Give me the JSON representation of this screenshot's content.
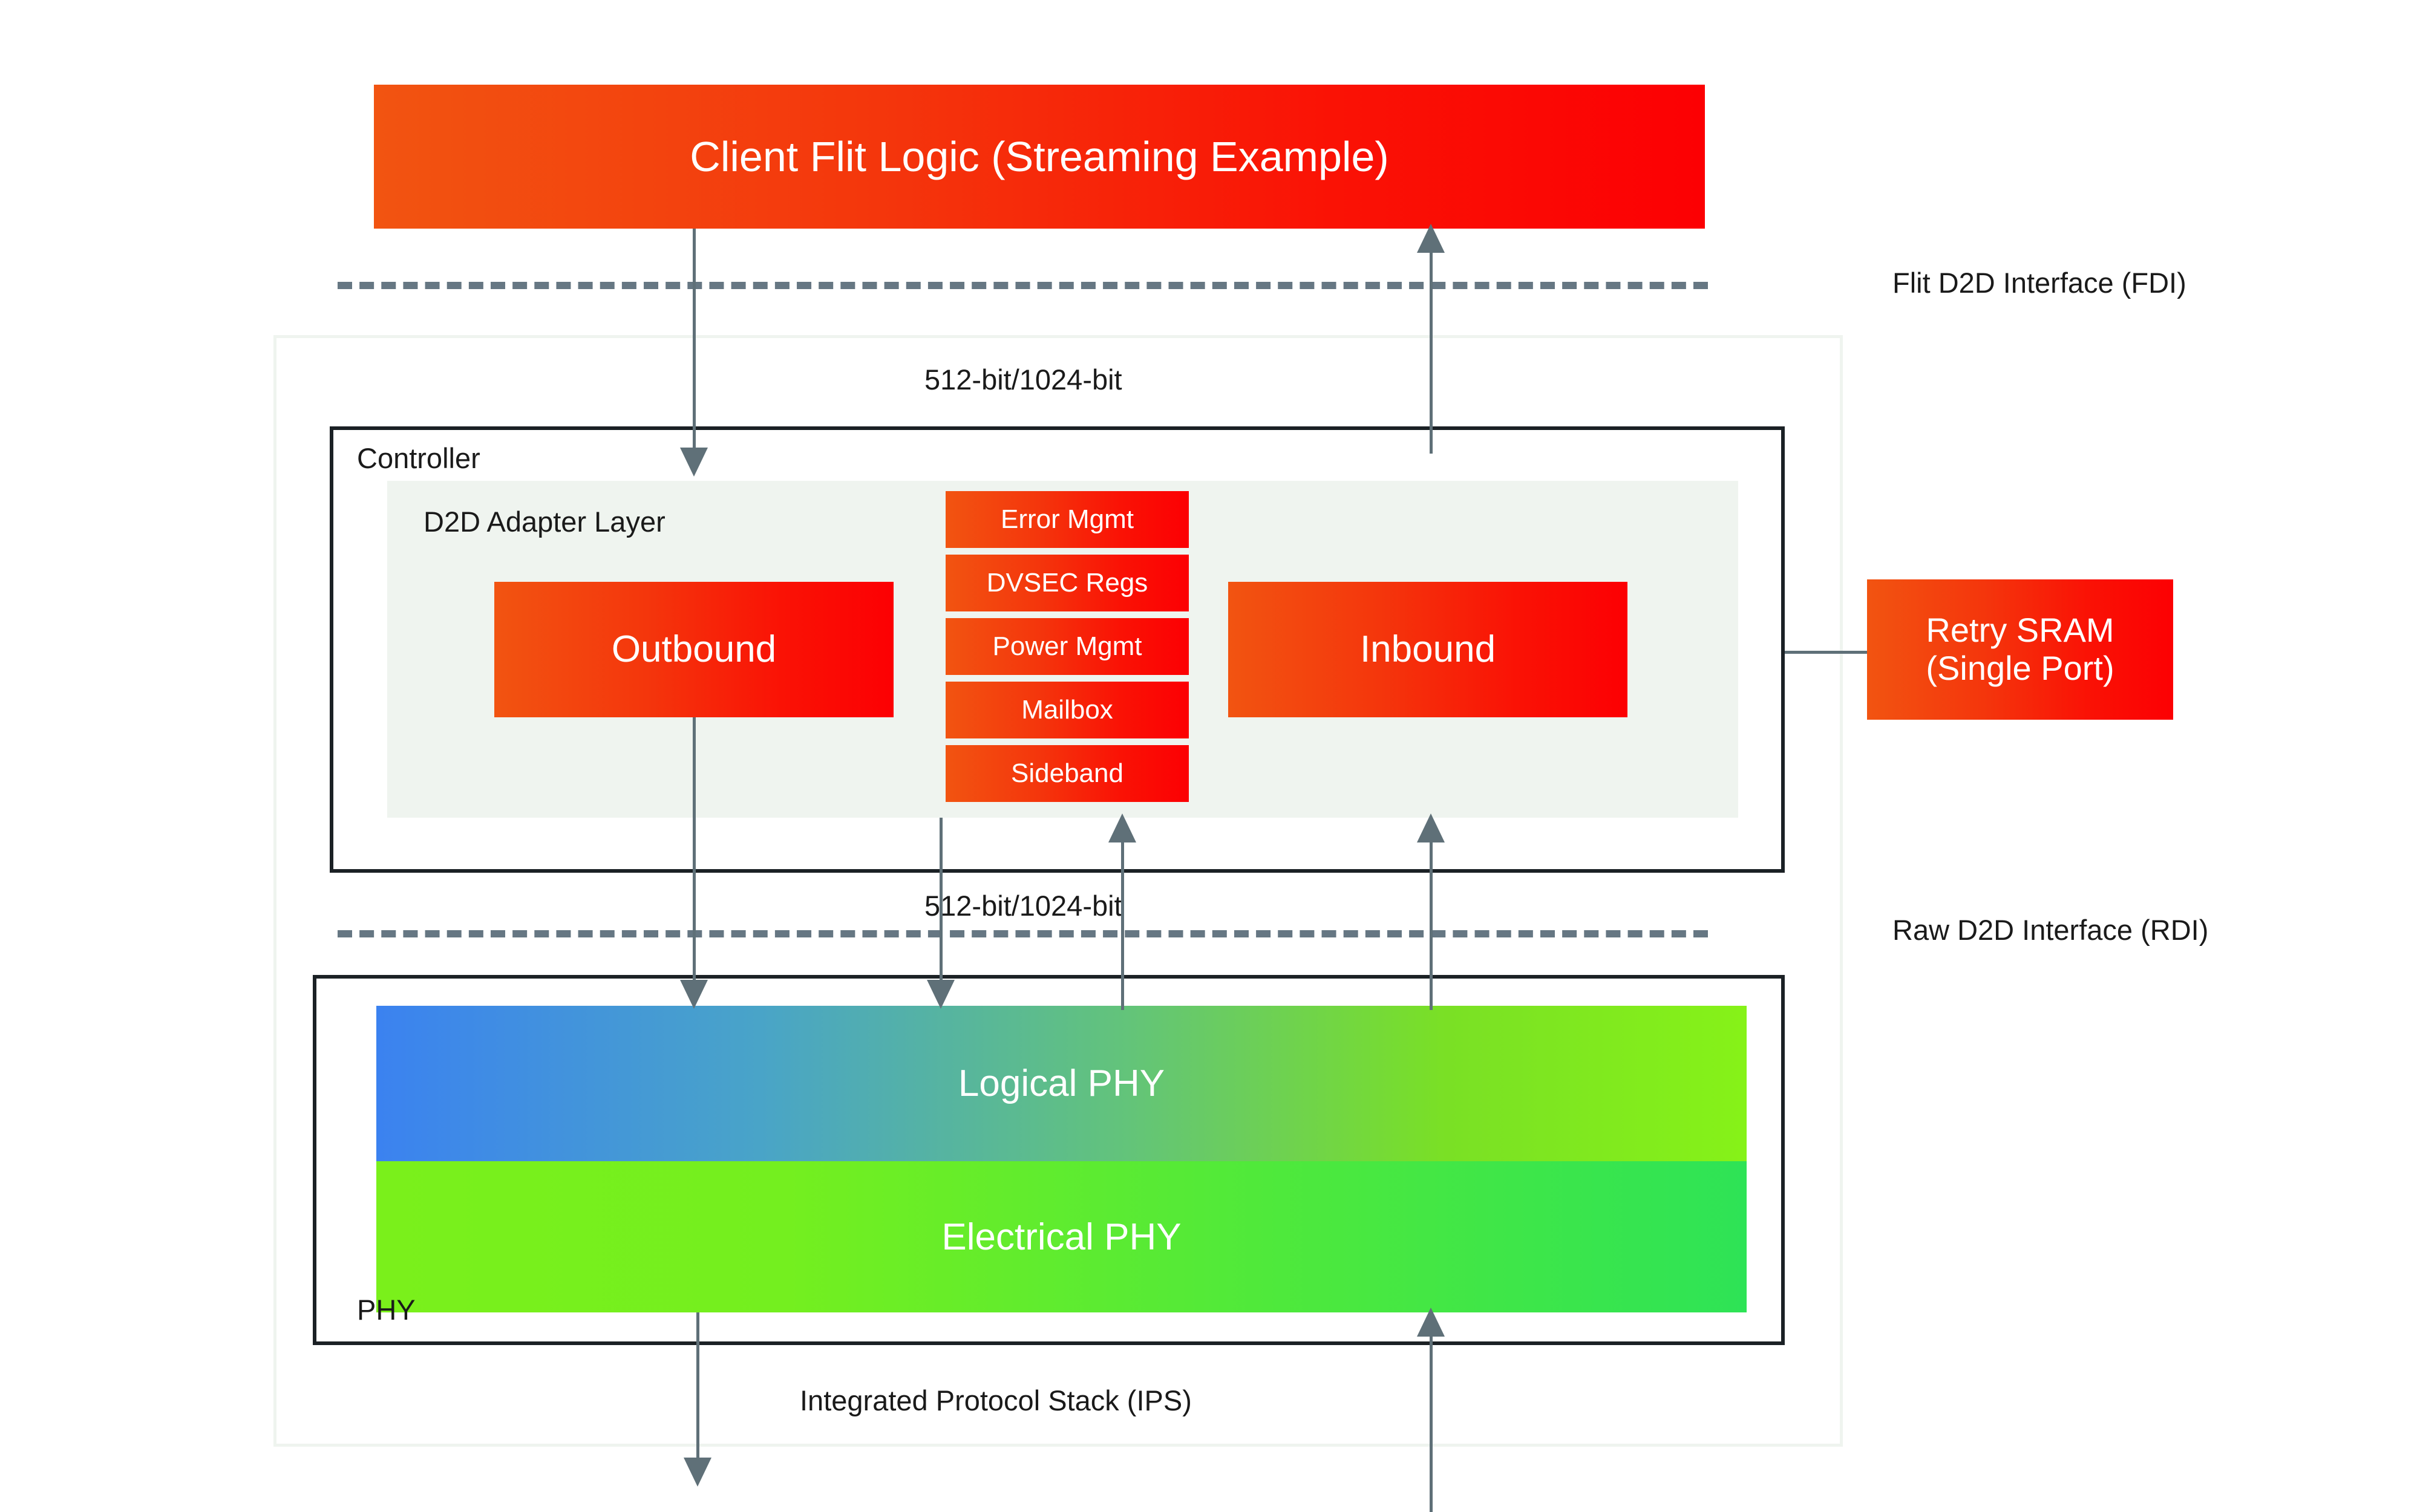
{
  "diagram": {
    "title_block": {
      "label": "Client Flit Logic (Streaming Example)"
    },
    "interfaces": [
      {
        "id": "fdi",
        "label": "Flit D2D Interface (FDI)"
      },
      {
        "id": "rdi",
        "label": "Raw D2D Interface (RDI)"
      }
    ],
    "bus_widths": {
      "fdi_width": "512-bit/1024-bit",
      "rdi_width": "512-bit/1024-bit"
    },
    "ips": {
      "label": "Integrated Protocol Stack (IPS)"
    },
    "controller": {
      "label": "Controller",
      "adapter": {
        "label": "D2D Adapter Layer",
        "outbound": "Outbound",
        "inbound": "Inbound",
        "services": [
          "Error Mgmt",
          "DVSEC Regs",
          "Power Mgmt",
          "Mailbox",
          "Sideband"
        ]
      }
    },
    "retry_sram": {
      "line1": "Retry SRAM",
      "line2": "(Single Port)"
    },
    "phy": {
      "label": "PHY",
      "logical": "Logical PHY",
      "electrical": "Electrical PHY"
    },
    "colors": {
      "red_gradient_start": "#f25411",
      "red_gradient_end": "#fc0003",
      "phy_logical_start": "#3b82f0",
      "phy_logical_end": "#86f218",
      "phy_electrical_start": "#7af01b",
      "phy_electrical_end": "#2ee356",
      "panel_bg": "#eff4ef",
      "border": "#1b2125",
      "connector": "#5f7078",
      "dash": "#667783"
    }
  }
}
